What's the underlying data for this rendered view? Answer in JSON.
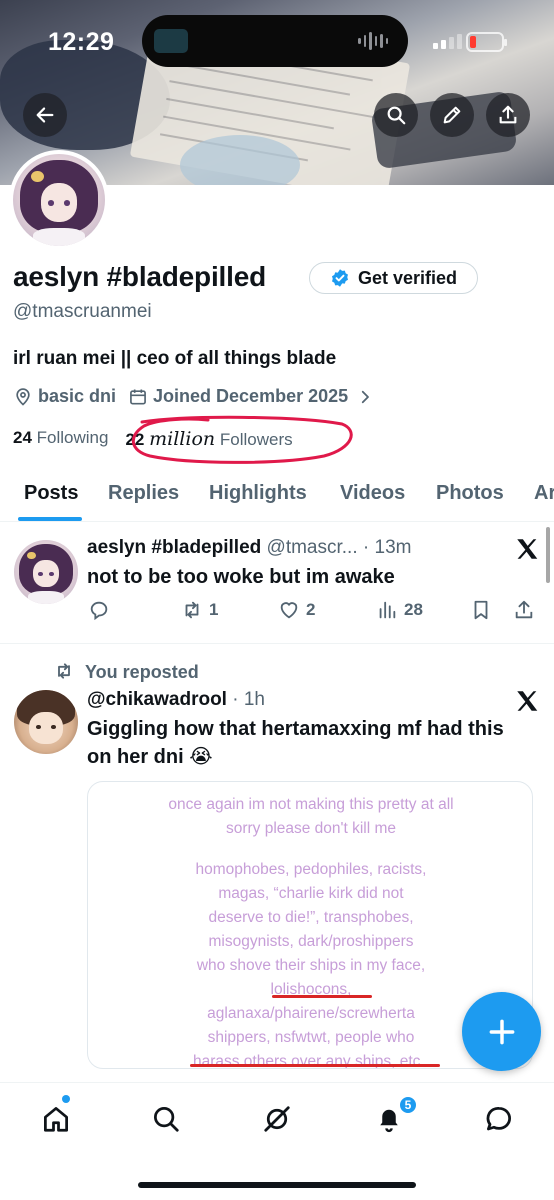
{
  "status_bar": {
    "time": "12:29"
  },
  "header_buttons": [
    "back-arrow-icon",
    "search-icon",
    "edit-pencil-icon",
    "share-icon"
  ],
  "profile": {
    "display_name": "aeslyn #bladepilled",
    "get_verified_label": "Get verified",
    "handle": "@tmascruanmei",
    "bio": "irl ruan mei || ceo of all things blade",
    "location": "basic dni",
    "joined": "Joined December 2025",
    "following_count": "24",
    "following_label": "Following",
    "followers_count": "22",
    "followers_handwritten": "million",
    "followers_label": "Followers"
  },
  "tabs": [
    "Posts",
    "Replies",
    "Highlights",
    "Videos",
    "Photos",
    "Ar"
  ],
  "active_tab": "Posts",
  "posts": [
    {
      "author": "aeslyn #bladepilled",
      "handle": "@tmascr...",
      "time": "· 13m",
      "text": "not to be too woke but im awake",
      "replies": "",
      "reposts": "1",
      "likes": "2",
      "views": "28"
    },
    {
      "repost_label": "You reposted",
      "handle": "@chikawadrool",
      "time": "· 1h",
      "text_line1": "Giggling how that hertamaxxing mf had this",
      "text_line2": "on her dni 😭",
      "media_lines": [
        "once again im not making this pretty at all",
        "sorry please don't kill me",
        "homophobes, pedophiles, racists,",
        "magas, “charlie kirk did not",
        "deserve to die!”, transphobes,",
        "misogynists, dark/proshippers",
        "who shove their ships in my face,",
        "lolishocons,",
        "aglanaxa/phairene/screwherta",
        "shippers, nsfwtwt, people who",
        "harass others over any ships, etc.."
      ]
    }
  ],
  "bottom_nav": {
    "notifications_badge": "5"
  },
  "colors": {
    "accent": "#1d9bf0",
    "annotation": "#e0194a",
    "text_muted": "#536471"
  }
}
